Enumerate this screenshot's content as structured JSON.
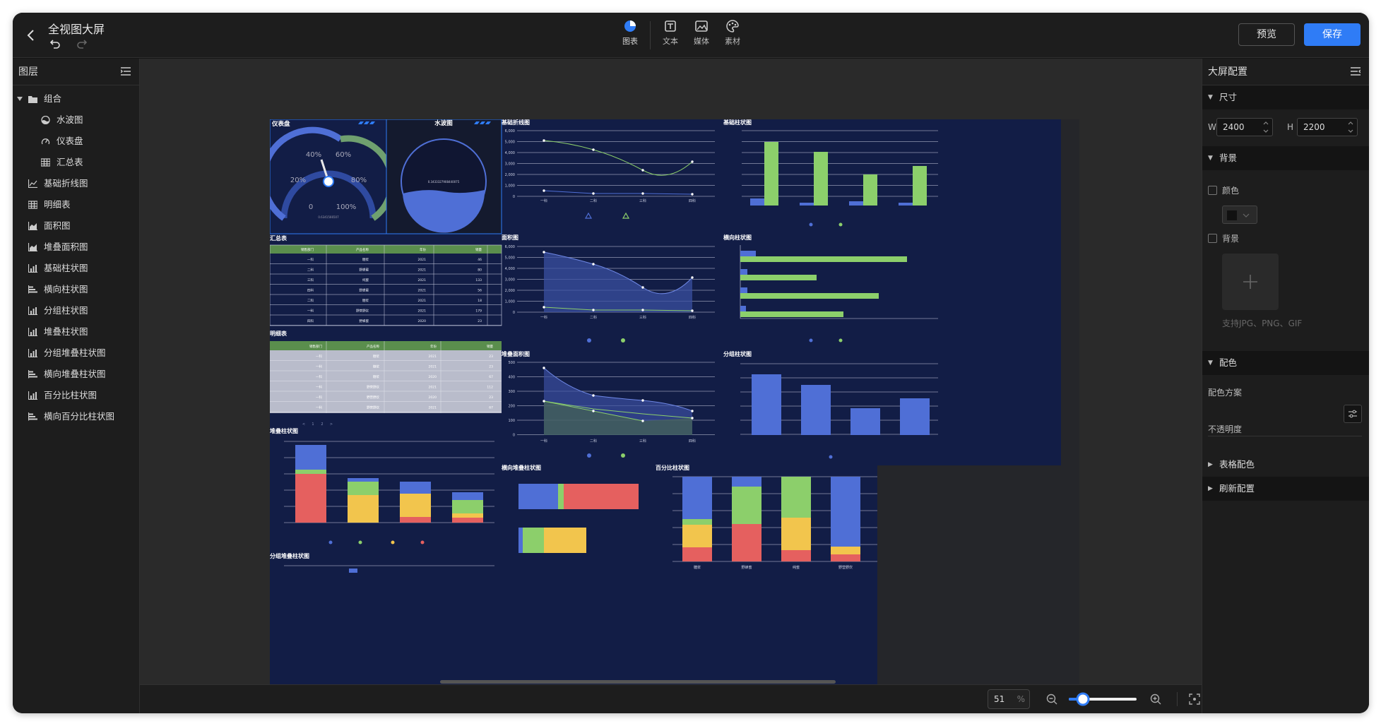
{
  "header": {
    "title": "全视图大屏",
    "tools": [
      {
        "label": "图表",
        "icon": "pie-chart-icon"
      },
      {
        "label": "文本",
        "icon": "text-icon"
      },
      {
        "label": "媒体",
        "icon": "image-icon"
      },
      {
        "label": "素材",
        "icon": "palette-icon"
      }
    ],
    "preview_label": "预览",
    "save_label": "保存",
    "accent": "#2f7cf6"
  },
  "layers": {
    "title": "图层",
    "items": [
      {
        "label": "组合",
        "icon": "folder-icon",
        "indent": 0,
        "expanded": true
      },
      {
        "label": "水波图",
        "icon": "wave-icon",
        "indent": 1
      },
      {
        "label": "仪表盘",
        "icon": "gauge-icon",
        "indent": 1
      },
      {
        "label": "汇总表",
        "icon": "table-icon",
        "indent": 1
      },
      {
        "label": "基础折线图",
        "icon": "line-chart-icon",
        "indent": 0
      },
      {
        "label": "明细表",
        "icon": "table-icon",
        "indent": 0
      },
      {
        "label": "面积图",
        "icon": "area-chart-icon",
        "indent": 0
      },
      {
        "label": "堆叠面积图",
        "icon": "area-chart-icon",
        "indent": 0
      },
      {
        "label": "基础柱状图",
        "icon": "bar-chart-icon",
        "indent": 0
      },
      {
        "label": "横向柱状图",
        "icon": "hbar-chart-icon",
        "indent": 0
      },
      {
        "label": "分组柱状图",
        "icon": "bar-chart-icon",
        "indent": 0
      },
      {
        "label": "堆叠柱状图",
        "icon": "bar-chart-icon",
        "indent": 0
      },
      {
        "label": "分组堆叠柱状图",
        "icon": "bar-chart-icon",
        "indent": 0
      },
      {
        "label": "横向堆叠柱状图",
        "icon": "hbar-chart-icon",
        "indent": 0
      },
      {
        "label": "百分比柱状图",
        "icon": "bar-chart-icon",
        "indent": 0
      },
      {
        "label": "横向百分比柱状图",
        "icon": "hbar-chart-icon",
        "indent": 0
      }
    ]
  },
  "canvas": {
    "widgets": {
      "gauge": {
        "title": "仪表盘",
        "labels": [
          "0",
          "20%",
          "40%",
          "60%",
          "80%",
          "100%"
        ],
        "value_text": "0.6341566507"
      },
      "water": {
        "title": "水波图",
        "value_text": "0.3433327908440075"
      },
      "line": {
        "title": "基础折线图",
        "yticks": [
          "6,000",
          "5,000",
          "4,000",
          "3,000",
          "2,000",
          "1,000",
          "0"
        ],
        "categories": [
          "一科",
          "二科",
          "三科",
          "四科"
        ]
      },
      "basic_bar": {
        "title": "基础柱状图"
      },
      "summary_table": {
        "title": "汇总表",
        "columns": [
          "销售部门",
          "产品名称",
          "年份",
          "销量"
        ],
        "rows": [
          [
            "一科",
            "糖浆",
            "2021",
            "46"
          ],
          [
            "二科",
            "野蜂蜜",
            "2021",
            "80"
          ],
          [
            "三科",
            "纯蜜",
            "2021",
            "133"
          ],
          [
            "四科",
            "野蜂蜜",
            "2021",
            "56"
          ],
          [
            "二科",
            "糖浆",
            "2021",
            "18"
          ],
          [
            "一科",
            "野营野炊",
            "2021",
            "179"
          ],
          [
            "四科",
            "野蜂蜜",
            "2020",
            "23"
          ]
        ]
      },
      "detail_table": {
        "title": "明细表",
        "columns": [
          "销售部门",
          "产品名称",
          "年份",
          "销量"
        ],
        "rows": [
          [
            "一科",
            "糖浆",
            "2021",
            "23"
          ],
          [
            "一科",
            "糖浆",
            "2021",
            "23"
          ],
          [
            "一科",
            "糖浆",
            "2020",
            "67"
          ],
          [
            "一科",
            "野营野炊",
            "2021",
            "112"
          ],
          [
            "一科",
            "野营野炊",
            "2020",
            "23"
          ],
          [
            "一科",
            "野营野炊",
            "2021",
            "67"
          ]
        ],
        "pagination": [
          "<",
          "1",
          "2",
          ">"
        ]
      },
      "area": {
        "title": "面积图",
        "yticks": [
          "6,000",
          "5,000",
          "4,000",
          "3,000",
          "2,000",
          "1,000",
          "0"
        ],
        "categories": [
          "一科",
          "二科",
          "三科",
          "四科"
        ]
      },
      "hbar": {
        "title": "横向柱状图"
      },
      "stacked_area": {
        "title": "堆叠面积图",
        "yticks": [
          "500",
          "400",
          "300",
          "200",
          "100",
          "0"
        ],
        "categories": [
          "一科",
          "二科",
          "三科",
          "四科"
        ]
      },
      "group_bar": {
        "title": "分组柱状图"
      },
      "stacked_bar": {
        "title": "堆叠柱状图"
      },
      "hstacked_bar": {
        "title": "横向堆叠柱状图"
      },
      "percent_bar": {
        "title": "百分比柱状图",
        "categories": [
          "糖浆",
          "野蜂蜜",
          "纯蜜",
          "野营野炊"
        ]
      },
      "group_stacked_bar": {
        "title": "分组堆叠柱状图"
      }
    },
    "zoom_value": "51",
    "zoom_unit": "%"
  },
  "config": {
    "title": "大屏配置",
    "size_section": "尺寸",
    "w_label": "W",
    "w_value": "2400",
    "h_label": "H",
    "h_value": "2200",
    "bg_section": "背景",
    "color_label": "颜色",
    "bg_label": "背景",
    "upload_hint": "支持JPG、PNG、GIF",
    "palette_section": "配色",
    "palette_scheme": "配色方案",
    "opacity_label": "不透明度",
    "table_color": "表格配色",
    "refresh": "刷新配置"
  },
  "colors": {
    "blue": "#4f6fd6",
    "green": "#8ccf6b",
    "red": "#e5605f",
    "yellow": "#f2c54d",
    "navy": "#121d46"
  }
}
